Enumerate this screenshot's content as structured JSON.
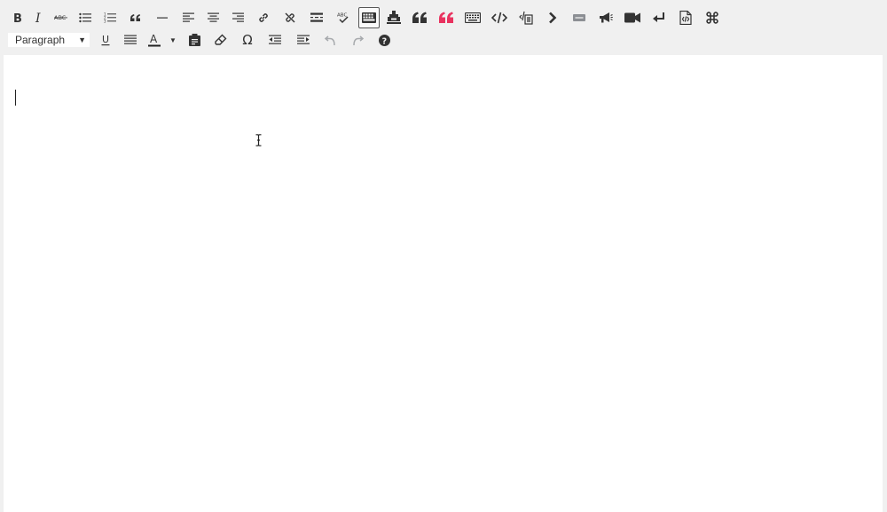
{
  "toolbar": {
    "row1": [
      {
        "name": "bold-button",
        "icon": "bold-icon"
      },
      {
        "name": "italic-button",
        "icon": "italic-icon"
      },
      {
        "name": "strikethrough-button",
        "icon": "strikethrough-icon"
      },
      {
        "name": "bulleted-list-button",
        "icon": "bulleted-list-icon"
      },
      {
        "name": "numbered-list-button",
        "icon": "numbered-list-icon"
      },
      {
        "name": "blockquote-button",
        "icon": "blockquote-icon"
      },
      {
        "name": "horizontal-line-button",
        "icon": "horizontal-line-icon"
      },
      {
        "name": "align-left-button",
        "icon": "align-left-icon"
      },
      {
        "name": "align-center-button",
        "icon": "align-center-icon"
      },
      {
        "name": "align-right-button",
        "icon": "align-right-icon"
      },
      {
        "name": "insert-link-button",
        "icon": "link-icon"
      },
      {
        "name": "remove-link-button",
        "icon": "unlink-icon"
      },
      {
        "name": "read-more-button",
        "icon": "read-more-icon"
      },
      {
        "name": "spellcheck-button",
        "icon": "spellcheck-icon"
      },
      {
        "name": "toolbar-toggle-button",
        "icon": "keyboard-icon",
        "active": true
      },
      {
        "name": "shortcode-button",
        "icon": "stamp-icon"
      },
      {
        "name": "quote-button",
        "icon": "quote-icon"
      },
      {
        "name": "pink-quote-button",
        "icon": "quote-icon",
        "color": "#e9325f"
      },
      {
        "name": "keyboard-button",
        "icon": "keyboard-icon"
      },
      {
        "name": "code-button",
        "icon": "code-icon"
      },
      {
        "name": "paste-code-button",
        "icon": "paste-code-icon"
      },
      {
        "name": "next-button",
        "icon": "chevron-right-icon"
      },
      {
        "name": "separator-button",
        "icon": "minus-box-icon",
        "color": "#8c8f94"
      },
      {
        "name": "announcement-button",
        "icon": "megaphone-icon"
      },
      {
        "name": "video-button",
        "icon": "video-camera-icon"
      },
      {
        "name": "line-break-button",
        "icon": "return-icon"
      },
      {
        "name": "document-code-button",
        "icon": "document-code-icon"
      },
      {
        "name": "command-button",
        "icon": "command-icon"
      }
    ],
    "format_select": {
      "value": "Paragraph"
    },
    "row2_glyphs": {
      "underline": "U",
      "text_color": "A",
      "special_char": "Ω",
      "help": "?"
    },
    "colors": {
      "accent_pink": "#e9325f",
      "icon": "#333333",
      "disabled": "#a7aaad",
      "toolbar_bg": "#f0f0f0",
      "editor_bg": "#ffffff"
    }
  },
  "editor": {
    "content": ""
  }
}
